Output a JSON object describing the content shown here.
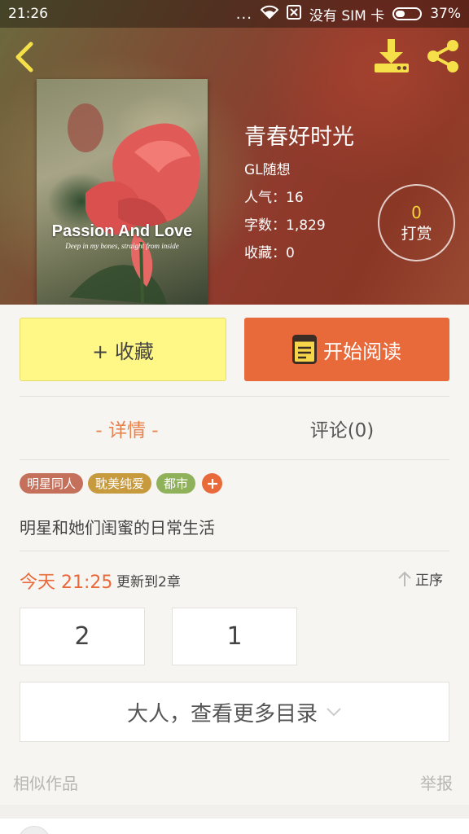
{
  "status_bar": {
    "time": "21:26",
    "dots": "...",
    "carrier": "没有 SIM 卡",
    "battery": "37%"
  },
  "header": {
    "back_icon": "chevron-left-icon",
    "download_icon": "download-icon",
    "share_icon": "share-icon"
  },
  "cover": {
    "title": "Passion And Love",
    "subtitle": "Deep in my bones, straight from inside"
  },
  "book": {
    "title": "青春好时光",
    "author": "GL随想",
    "popularity": "人气：16",
    "word_count": "字数：1,829",
    "favorites": "收藏：0"
  },
  "reward": {
    "count": "0",
    "label": "打赏"
  },
  "actions": {
    "collect_label": "+ 收藏",
    "read_label": "开始阅读"
  },
  "tabs": {
    "details": "- 详情 -",
    "comments": "评论(0)"
  },
  "tags": [
    {
      "label": "明星同人",
      "color": "#c4705a"
    },
    {
      "label": "耽美纯爱",
      "color": "#c79a3e"
    },
    {
      "label": "都市",
      "color": "#8fb15a"
    }
  ],
  "synopsis": "明星和她们闺蜜的日常生活",
  "update": {
    "time": "今天 21:25",
    "text": "更新到2章",
    "sort_label": "正序"
  },
  "chapters": [
    "2",
    "1"
  ],
  "more_catalog": "大人，查看更多目录",
  "footer": {
    "similar": "相似作品",
    "report": "举报"
  },
  "colors": {
    "accent": "#e8693a",
    "collect_button": "#fff786",
    "reward_count": "#f5d53a"
  }
}
